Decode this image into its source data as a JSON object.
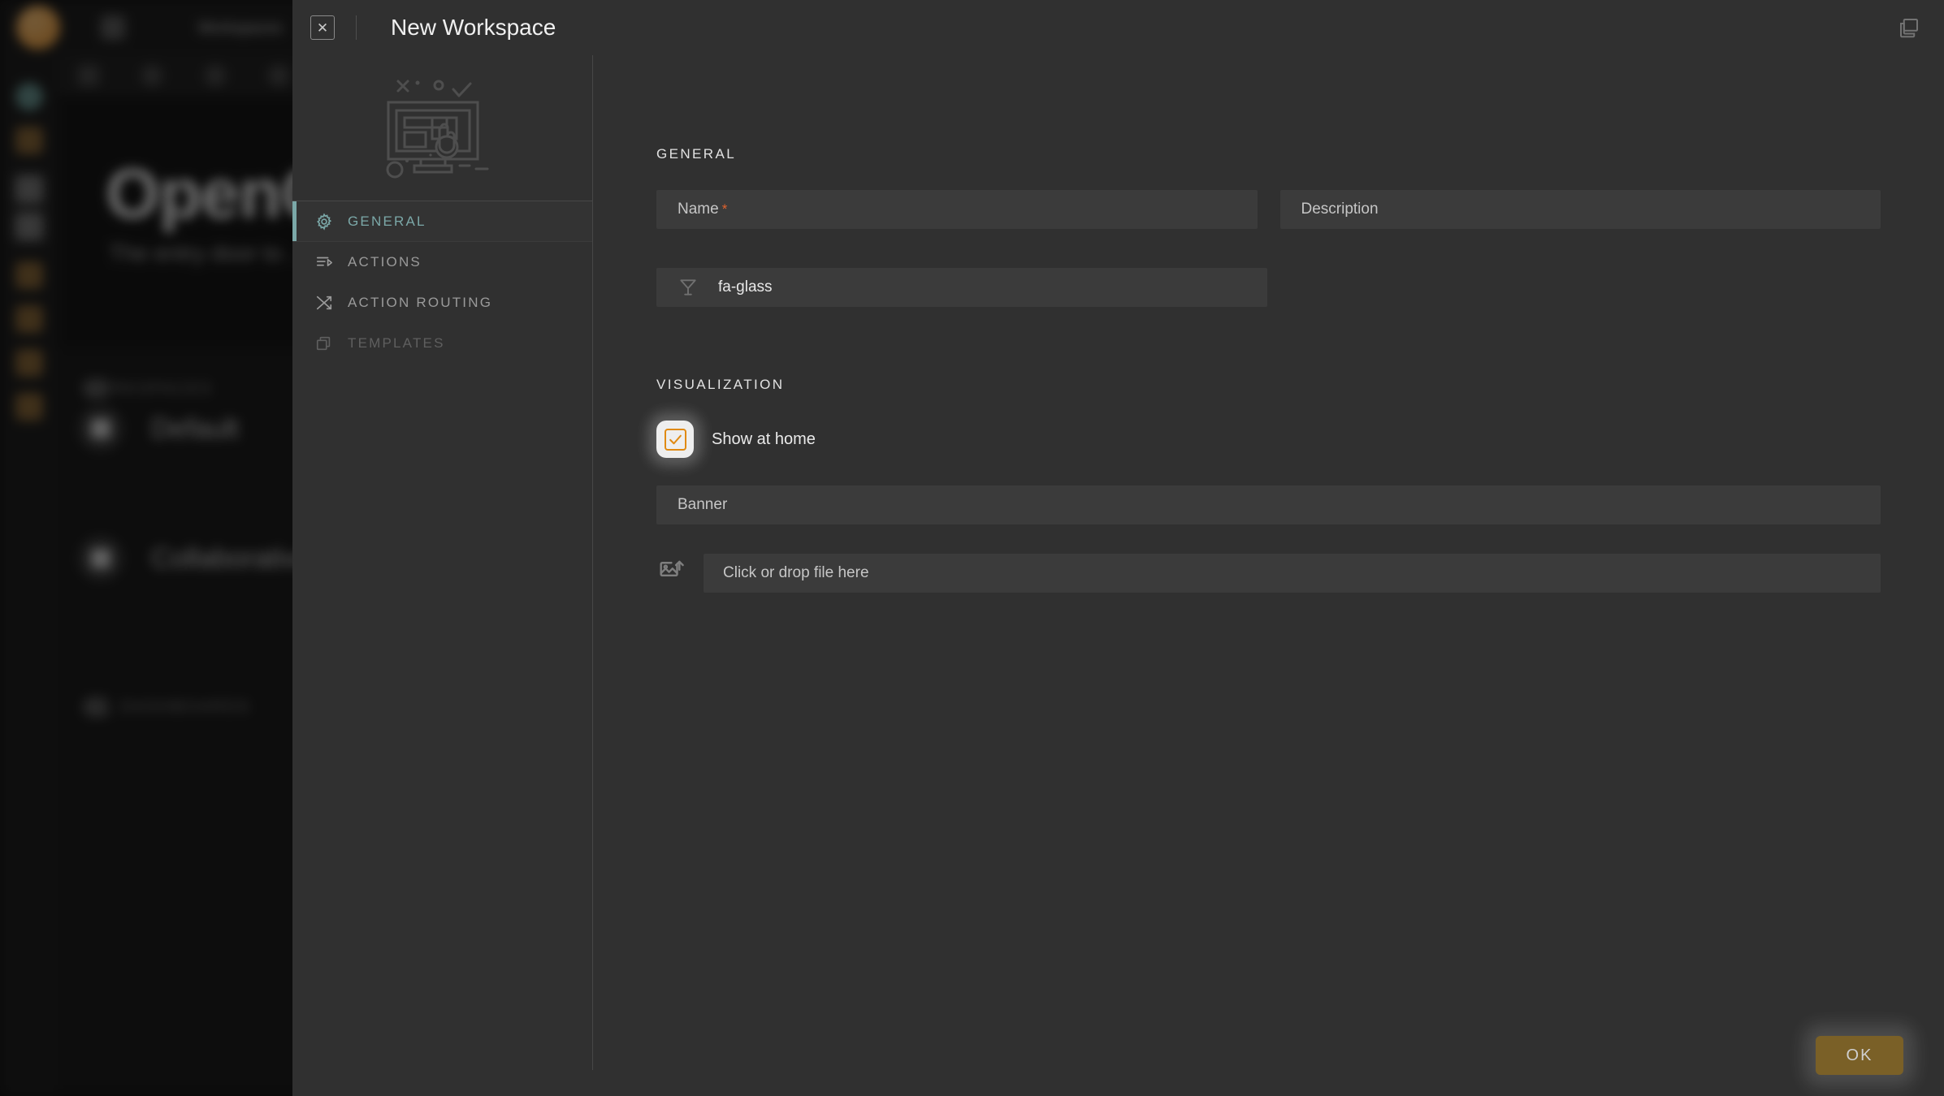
{
  "background": {
    "app_name": "OpenCTI",
    "hero_title": "OpenCTI",
    "hero_subtitle": "The entry door to ...",
    "topbar_title": "Workspaces",
    "section_label_1": "WORKSPACES",
    "section_label_2": "ALL DASHBOARDS",
    "card_1_label": "Default",
    "card_2_label": "Collaborative"
  },
  "modal": {
    "title": "New Workspace",
    "close_label": "✕",
    "header_icon": "copy-windows-icon",
    "illustration": "workspace-screen-illustration"
  },
  "sidebar": {
    "items": [
      {
        "label": "GENERAL",
        "icon": "gear-icon",
        "state": "active"
      },
      {
        "label": "ACTIONS",
        "icon": "list-play-icon",
        "state": "enabled"
      },
      {
        "label": "ACTION ROUTING",
        "icon": "shuffle-icon",
        "state": "enabled"
      },
      {
        "label": "TEMPLATES",
        "icon": "layers-stack-icon",
        "state": "disabled"
      }
    ]
  },
  "general": {
    "section_title": "GENERAL",
    "name": {
      "label": "Name",
      "value": "",
      "placeholder": "Name",
      "required_mark": "*"
    },
    "description": {
      "label": "Description",
      "value": "",
      "placeholder": "Description"
    },
    "icon_field": {
      "value": "fa-glass",
      "icon": "martini-glass-icon"
    }
  },
  "visualization": {
    "section_title": "VISUALIZATION",
    "show_at_home": {
      "label": "Show at home",
      "checked": true
    },
    "banner": {
      "label": "Banner",
      "value": "",
      "placeholder": "Banner"
    },
    "file_drop": {
      "label": "Click or drop file here",
      "icon": "image-upload-icon"
    }
  },
  "footer": {
    "ok_label": "OK"
  },
  "colors": {
    "accent_teal": "#7ba8a8",
    "accent_orange": "#E08A12",
    "required_red": "#e0622c",
    "ok_button": "#7a6027",
    "modal_bg": "#303030",
    "field_bg": "#3b3b3b"
  }
}
